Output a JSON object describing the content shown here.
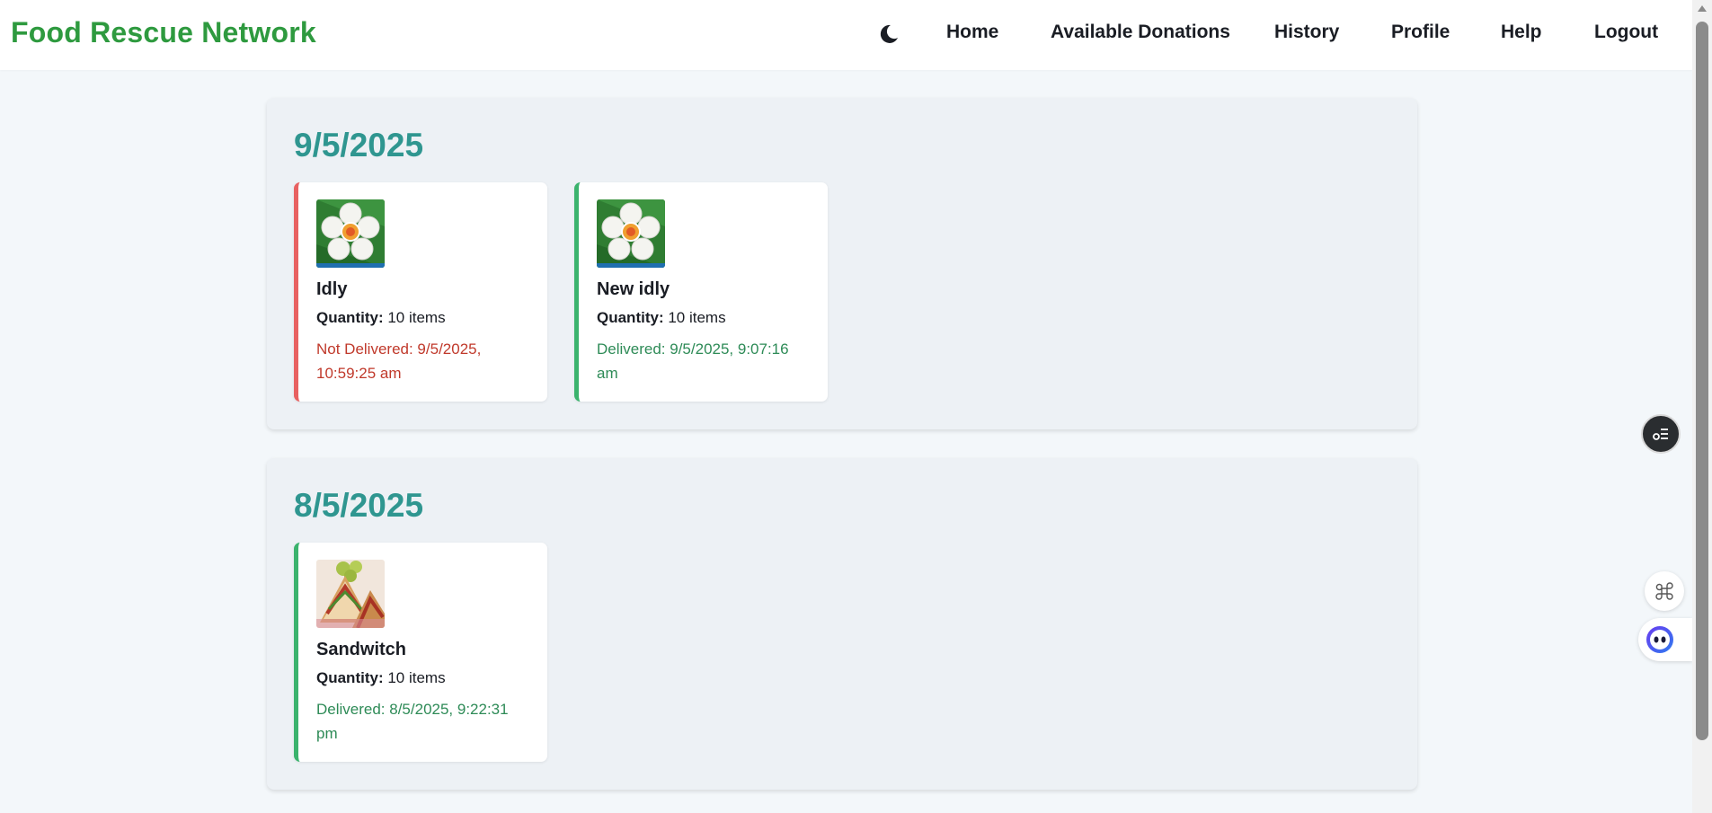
{
  "app": {
    "brand": "Food Rescue Network",
    "brand_color": "#2e9a3f"
  },
  "nav": {
    "theme_icon": "moon-icon",
    "links": [
      "Home",
      "Available Donations",
      "History",
      "Profile",
      "Help",
      "Logout"
    ]
  },
  "history": [
    {
      "date": "9/5/2025",
      "donations": [
        {
          "name": "Idly",
          "image_icon": "idly-photo",
          "quantity_label": "Quantity:",
          "quantity_value": "10 items",
          "status": "not-delivered",
          "status_text": "Not Delivered: 9/5/2025, 10:59:25 am"
        },
        {
          "name": "New idly",
          "image_icon": "idly-photo",
          "quantity_label": "Quantity:",
          "quantity_value": "10 items",
          "status": "delivered",
          "status_text": "Delivered: 9/5/2025, 9:07:16 am"
        }
      ]
    },
    {
      "date": "8/5/2025",
      "donations": [
        {
          "name": "Sandwitch",
          "image_icon": "sandwich-photo",
          "quantity_label": "Quantity:",
          "quantity_value": "10 items",
          "status": "delivered",
          "status_text": "Delivered: 8/5/2025, 9:22:31 pm"
        }
      ]
    }
  ],
  "colors": {
    "date_heading": "#2f9690",
    "not_delivered": "#c0392b",
    "delivered": "#2e8b57",
    "not_delivered_border": "#e86161",
    "delivered_border": "#3bb36d"
  },
  "floating": {
    "settings_icon": "toggle-list-icon",
    "shortcut_icon": "command-icon",
    "assistant_icon": "assistant-face-icon"
  }
}
